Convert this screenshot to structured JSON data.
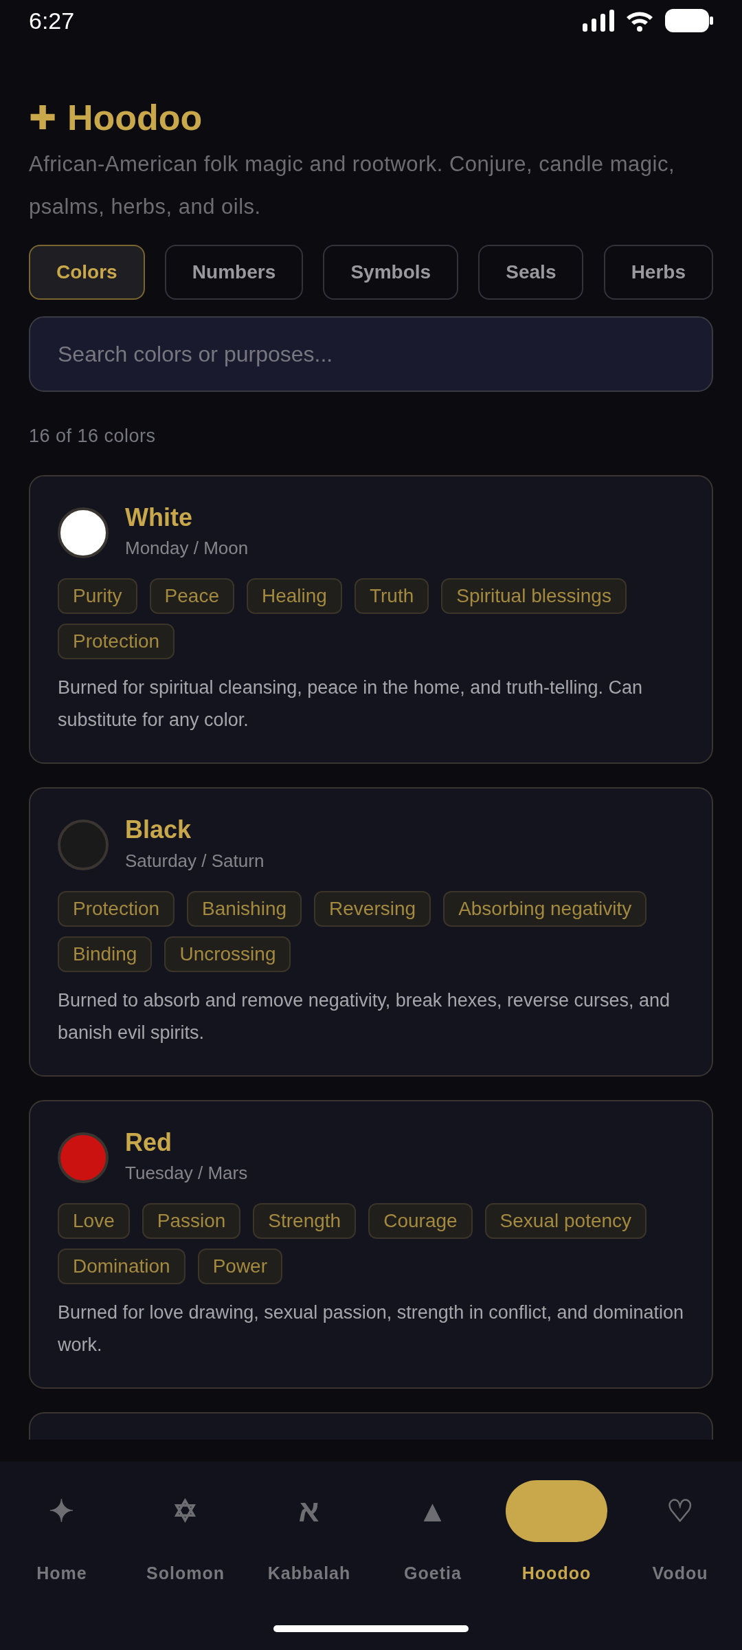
{
  "status_bar": {
    "time": "6:27"
  },
  "header": {
    "icon": "✚",
    "title": "Hoodoo",
    "subtitle": "African-American folk magic and rootwork. Conjure, candle magic, psalms, herbs, and oils."
  },
  "tabs": [
    {
      "label": "Colors",
      "selected": true
    },
    {
      "label": "Numbers",
      "selected": false
    },
    {
      "label": "Symbols",
      "selected": false
    },
    {
      "label": "Seals",
      "selected": false
    },
    {
      "label": "Herbs",
      "selected": false
    }
  ],
  "search": {
    "placeholder": "Search colors or purposes..."
  },
  "count": "16 of 16 colors",
  "cards": [
    {
      "name": "White",
      "day": "Monday / Moon",
      "color": "#ffffff",
      "tags": [
        "Purity",
        "Peace",
        "Healing",
        "Truth",
        "Spiritual blessings",
        "Protection"
      ],
      "description": "Burned for spiritual cleansing, peace in the home, and truth-telling. Can substitute for any color."
    },
    {
      "name": "Black",
      "day": "Saturday / Saturn",
      "color": "#1a1a1a",
      "tags": [
        "Protection",
        "Banishing",
        "Reversing",
        "Absorbing negativity",
        "Binding",
        "Uncrossing"
      ],
      "description": "Burned to absorb and remove negativity, break hexes, reverse curses, and banish evil spirits."
    },
    {
      "name": "Red",
      "day": "Tuesday / Mars",
      "color": "#cc1111",
      "tags": [
        "Love",
        "Passion",
        "Strength",
        "Courage",
        "Sexual potency",
        "Domination",
        "Power"
      ],
      "description": "Burned for love drawing, sexual passion, strength in conflict, and domination work."
    }
  ],
  "nav": [
    {
      "glyph": "✦",
      "label": "Home",
      "selected": false
    },
    {
      "glyph": "✡",
      "label": "Solomon",
      "selected": false
    },
    {
      "glyph": "א",
      "label": "Kabbalah",
      "selected": false
    },
    {
      "glyph": "▲",
      "label": "Goetia",
      "selected": false
    },
    {
      "label": "Hoodoo",
      "selected": true
    },
    {
      "glyph": "♡",
      "label": "Vodou",
      "selected": false
    }
  ]
}
